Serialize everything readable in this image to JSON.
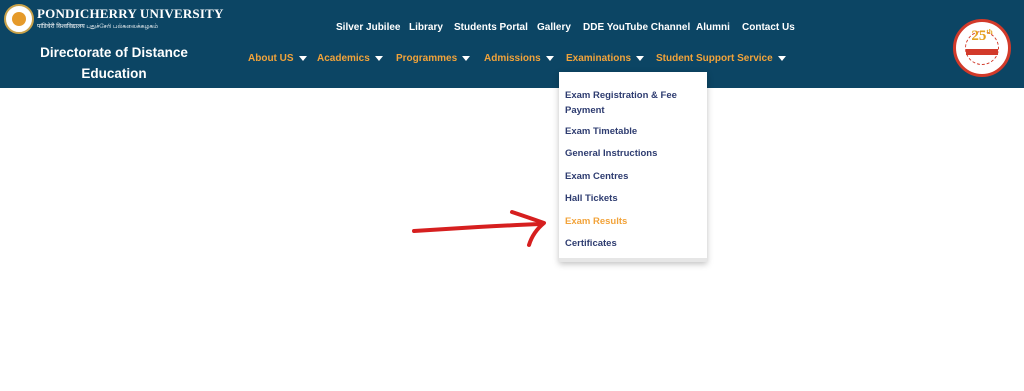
{
  "header": {
    "university_name": "PONDICHERRY UNIVERSITY",
    "university_subtitle": "पांडिचेरी विश्वविद्यालय    புதுச்சேரி பல்கலைக்கழகம்",
    "department": "Directorate of Distance Education",
    "anniversary_badge": "25",
    "anniversary_suffix": "th"
  },
  "top_nav": [
    "Silver Jubilee",
    "Library",
    "Students Portal",
    "Gallery",
    "DDE YouTube Channel",
    "Alumni",
    "Contact Us"
  ],
  "main_nav": [
    "About US",
    "Academics",
    "Programmes",
    "Admissions",
    "Examinations",
    "Student Support Service"
  ],
  "examinations_menu": {
    "items": [
      "Exam Registration & Fee Payment",
      "Exam Timetable",
      "General Instructions",
      "Exam Centres",
      "Hall Tickets",
      "Exam Results",
      "Certificates"
    ],
    "active": "Exam Results"
  },
  "colors": {
    "header_bg": "#0c4564",
    "nav_accent": "#f2a33a",
    "menu_text": "#2e3c70",
    "annotation_arrow": "#d61f1f"
  },
  "icons": [
    "university-emblem-icon",
    "anniversary-badge-icon",
    "caret-down-icon",
    "red-arrow-annotation"
  ]
}
